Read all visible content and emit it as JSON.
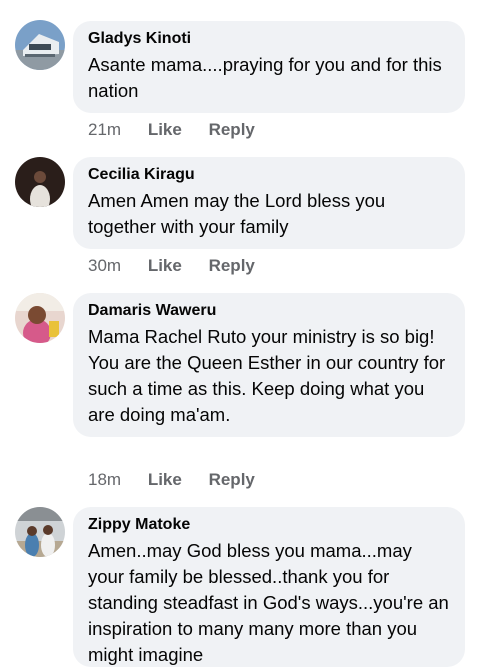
{
  "comments": [
    {
      "name": "Gladys Kinoti",
      "text": "Asante mama....praying for you and for this nation",
      "time": "21m",
      "like": "Like",
      "reply": "Reply",
      "avatar": "house-photo"
    },
    {
      "name": "Cecilia Kiragu",
      "text": "Amen Amen may the Lord bless you together with your family",
      "time": "30m",
      "like": "Like",
      "reply": "Reply",
      "avatar": "person-dark-photo"
    },
    {
      "name": "Damaris Waweru",
      "text": "Mama Rachel Ruto your ministry is so big!\nYou are the Queen Esther in our country for such a time as this. Keep doing what you are doing ma'am.",
      "time": "18m",
      "like": "Like",
      "reply": "Reply",
      "avatar": "child-photo"
    },
    {
      "name": "Zippy Matoke",
      "text": "Amen..may God bless you mama...may your family be blessed..thank you for standing steadfast in God's ways...you're an inspiration to many many more than you might imagine",
      "time": "",
      "like": "",
      "reply": "",
      "avatar": "couple-photo"
    }
  ]
}
